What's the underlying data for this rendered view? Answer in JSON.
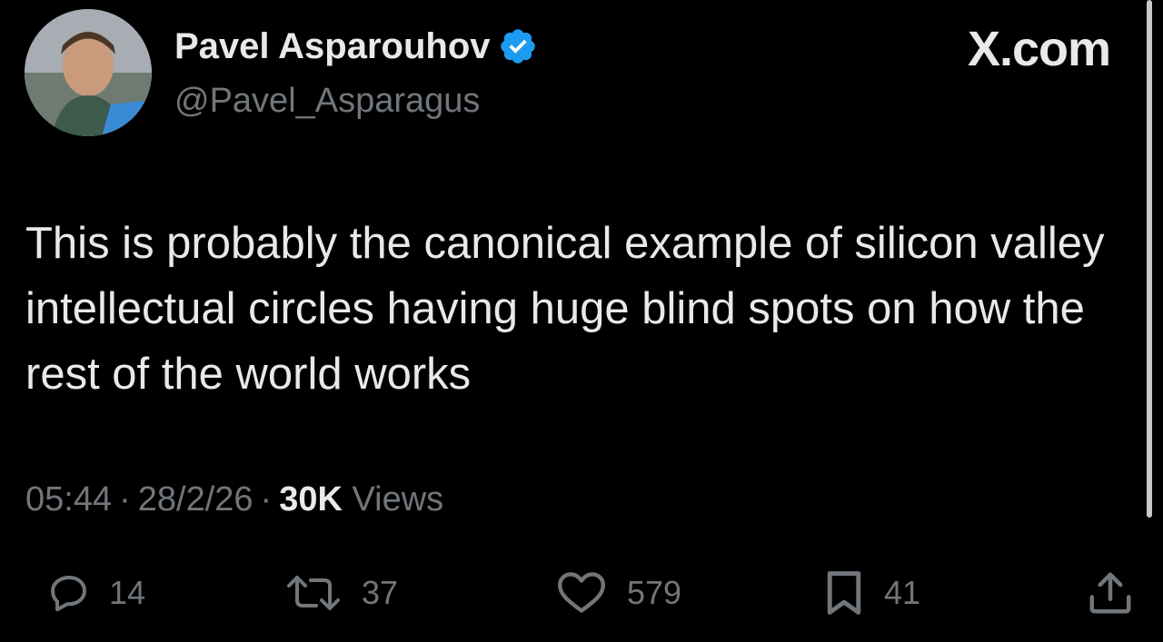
{
  "author": {
    "display_name": "Pavel Asparouhov",
    "handle": "@Pavel_Asparagus",
    "verified": true
  },
  "brand": "X.com",
  "tweet": {
    "text": "This is probably the canonical example of silicon valley intellectual circles having huge blind spots on how the rest of the world works"
  },
  "meta": {
    "time": "05:44",
    "separator": "·",
    "date": "28/2/26",
    "views_count": "30K",
    "views_label": "Views"
  },
  "actions": {
    "replies": "14",
    "reposts": "37",
    "likes": "579",
    "bookmarks": "41"
  },
  "icons": {
    "reply": "reply-icon",
    "repost": "repost-icon",
    "like": "heart-icon",
    "bookmark": "bookmark-icon",
    "share": "share-icon",
    "verified": "verified-badge-icon"
  },
  "colors": {
    "background": "#000000",
    "primary_text": "#e7e9ea",
    "secondary_text": "#71767b",
    "verified_blue": "#1d9bf0"
  }
}
